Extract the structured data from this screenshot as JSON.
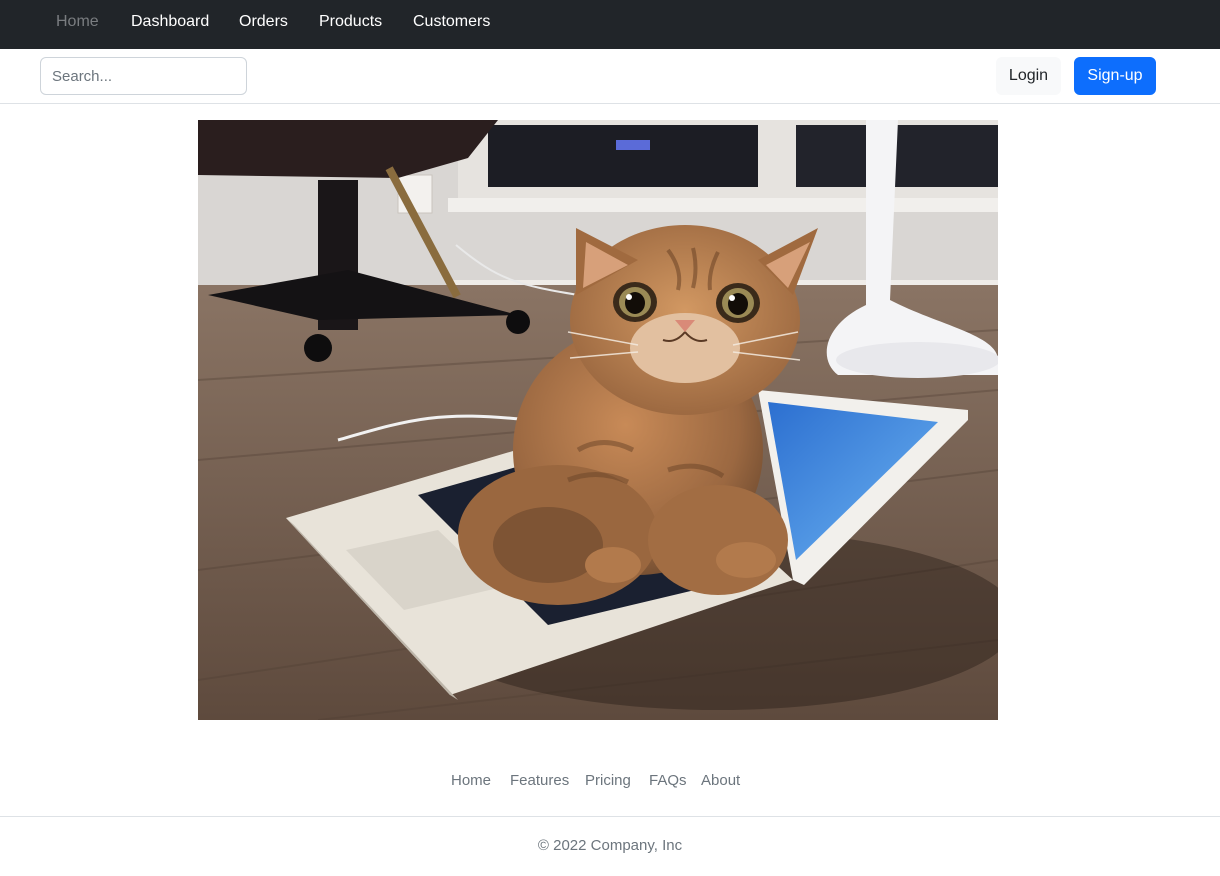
{
  "topnav": {
    "items": [
      {
        "label": "Home",
        "active": true
      },
      {
        "label": "Dashboard"
      },
      {
        "label": "Orders"
      },
      {
        "label": "Products"
      },
      {
        "label": "Customers"
      }
    ]
  },
  "toolbar": {
    "search_placeholder": "Search...",
    "login_label": "Login",
    "signup_label": "Sign-up",
    "primary_color": "#0d6efd"
  },
  "main": {
    "image": {
      "icon": "photo-cat-on-laptop"
    }
  },
  "footer": {
    "links": [
      "Home",
      "Features",
      "Pricing",
      "FAQs",
      "About"
    ],
    "copyright": "© 2022 Company, Inc"
  }
}
